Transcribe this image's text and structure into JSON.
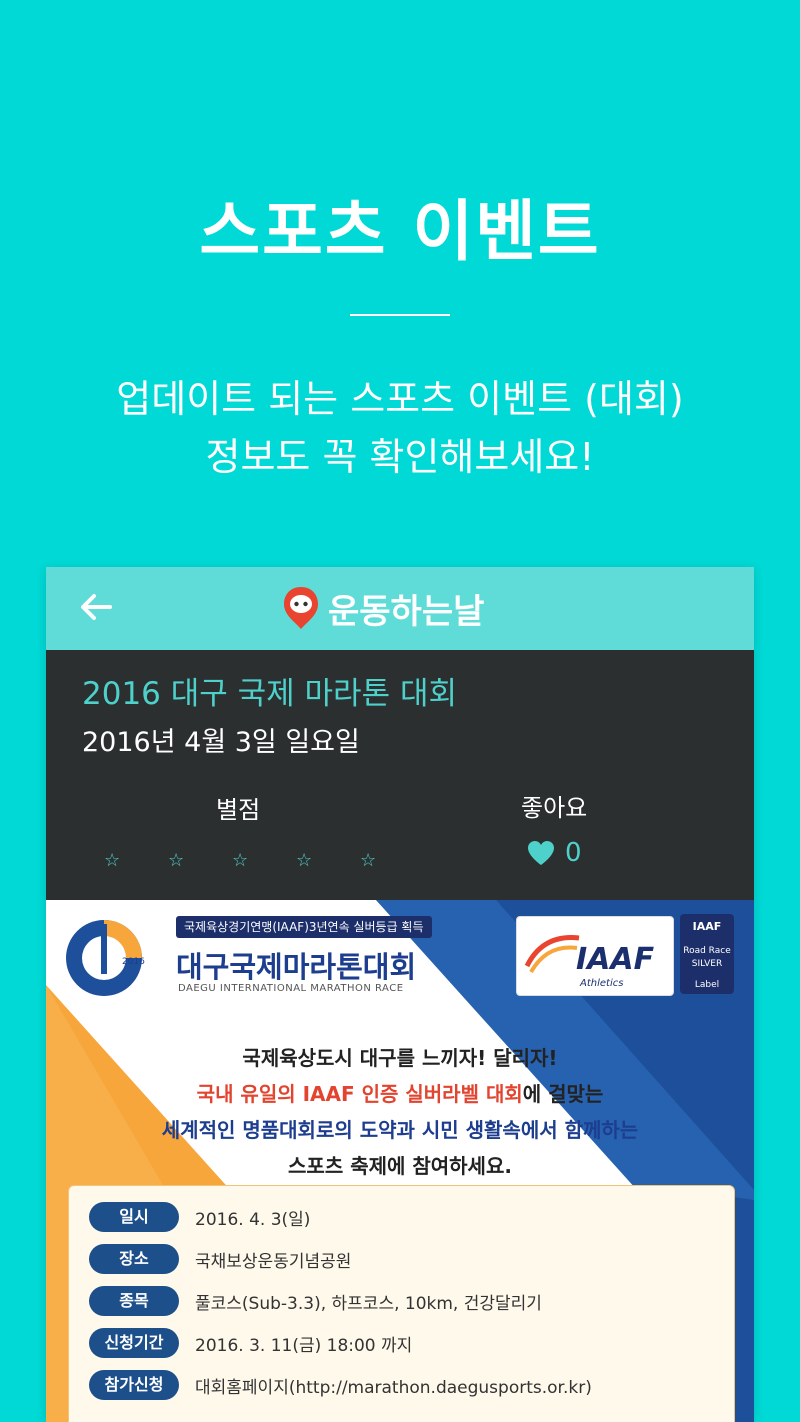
{
  "hero": {
    "title": "스포츠 이벤트",
    "subtitle_line1": "업데이트 되는 스포츠 이벤트 (대회)",
    "subtitle_line2": "정보도 꼭 확인해보세요!"
  },
  "app": {
    "brand_name": "운동하는날",
    "accent_color": "#4fd1cb"
  },
  "event": {
    "title": "2016 대구 국제 마라톤 대회",
    "date": "2016년 4월 3일 일요일",
    "rating_label": "별점",
    "rating_value": 0,
    "rating_max": 5,
    "stars": [
      "☆",
      "☆",
      "☆",
      "☆",
      "☆"
    ],
    "like_label": "좋아요",
    "like_count": "0"
  },
  "poster": {
    "badge": "국제육상경기연맹(IAAF)3년연속 실버등급 획득",
    "name": "대구국제마라톤대회",
    "name_eng": "DAEGU INTERNATIONAL MARATHON RACE",
    "iaaf": "IAAF",
    "iaaf_sub": "Athletics",
    "silver_badge": [
      "IAAF",
      "Road Race",
      "SILVER",
      "Label"
    ],
    "slogan_line1": "국제육상도시 대구를 느끼자! 달리자!",
    "slogan_line2_highlight": "국내 유일의 IAAF 인증 실버라벨 대회",
    "slogan_line2_rest": "에 걸맞는",
    "slogan_line3": "세계적인 명품대회로의 도약과 시민 생활속에서 함께하는",
    "slogan_line4": "스포츠 축제에 참여하세요.",
    "info": [
      {
        "key": "일시",
        "value": "2016. 4. 3(일)"
      },
      {
        "key": "장소",
        "value": "국채보상운동기념공원"
      },
      {
        "key": "종목",
        "value": "풀코스(Sub-3.3), 하프코스, 10km, 건강달리기"
      },
      {
        "key": "신청기간",
        "value": "2016. 3. 11(금) 18:00 까지"
      },
      {
        "key": "참가신청",
        "value": "대회홈페이지(http://marathon.daegusports.or.kr)"
      }
    ]
  }
}
